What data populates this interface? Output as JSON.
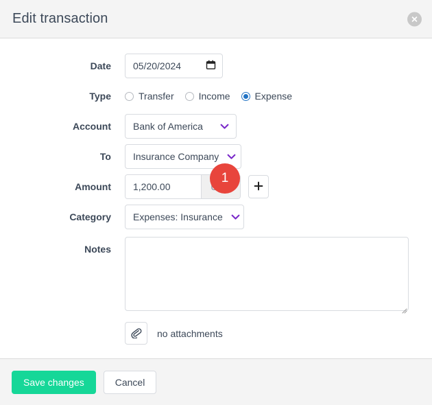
{
  "dialog": {
    "title": "Edit transaction",
    "close_icon": "close-circle-icon"
  },
  "form": {
    "date": {
      "label": "Date",
      "value": "05/20/2024",
      "icon": "calendar-icon"
    },
    "type": {
      "label": "Type",
      "options": [
        {
          "label": "Transfer",
          "selected": false
        },
        {
          "label": "Income",
          "selected": false
        },
        {
          "label": "Expense",
          "selected": true
        }
      ]
    },
    "account": {
      "label": "Account",
      "value": "Bank of America",
      "icon": "chevron-down-icon"
    },
    "to": {
      "label": "To",
      "value": "Insurance Company",
      "icon": "chevron-down-icon"
    },
    "amount": {
      "label": "Amount",
      "value": "1,200.00",
      "currency": "USD",
      "add_button_label": "+",
      "badge": "1"
    },
    "category": {
      "label": "Category",
      "value": "Expenses: Insurance",
      "icon": "chevron-down-icon"
    },
    "notes": {
      "label": "Notes",
      "value": "",
      "placeholder": ""
    },
    "attachments": {
      "icon": "paperclip-icon",
      "text": "no attachments"
    }
  },
  "footer": {
    "save_label": "Save changes",
    "cancel_label": "Cancel"
  },
  "colors": {
    "accent_green": "#16d798",
    "badge_red": "#e8453c",
    "radio_blue": "#2273c4",
    "chevron_purple": "#7a29c9",
    "header_bg": "#f4f4f4"
  }
}
